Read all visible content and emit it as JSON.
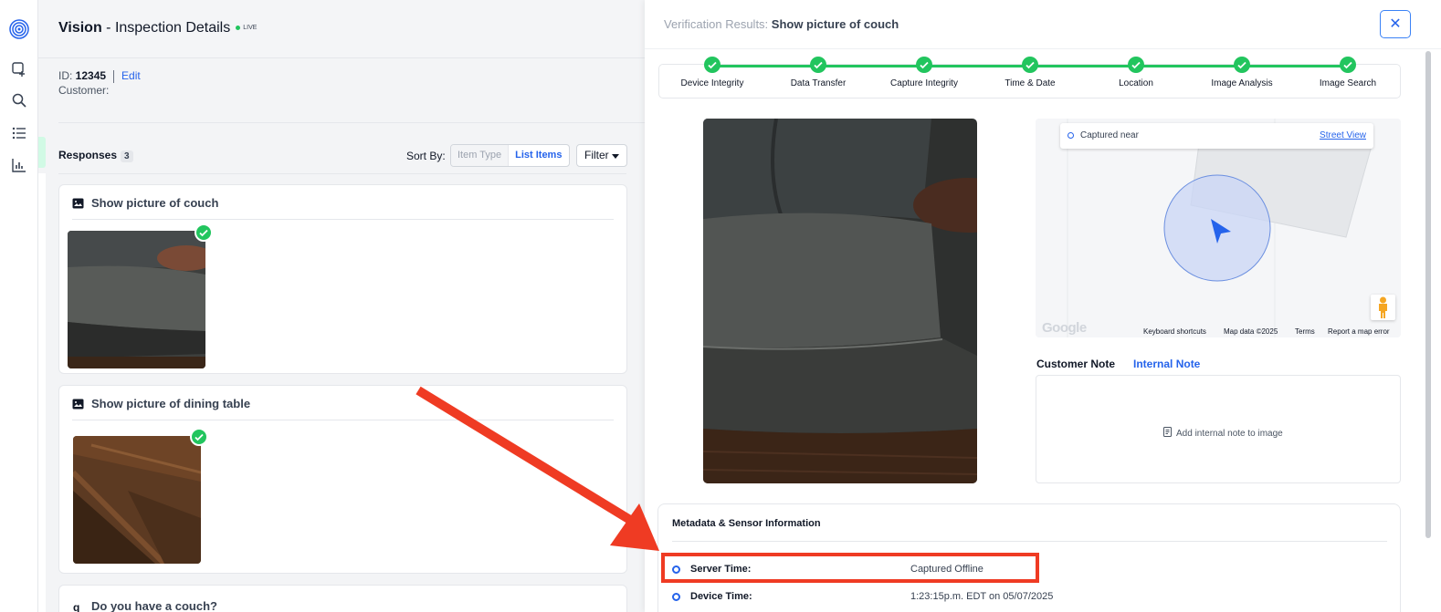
{
  "header": {
    "app_name": "Vision",
    "title_rest": " - Inspection Details",
    "live_label": "LIVE"
  },
  "inspection": {
    "id_label": "ID: ",
    "id_value": "12345",
    "edit_label": "Edit",
    "customer_label": "Customer:"
  },
  "responses": {
    "label": "Responses",
    "count": "3",
    "sort_by_label": "Sort By:",
    "sort_options": [
      "Item Type",
      "List Items"
    ],
    "selected_sort": "List Items",
    "filter_label": "Filter"
  },
  "cards": [
    {
      "title": "Show picture of couch",
      "verified": true
    },
    {
      "title": "Show picture of dining table",
      "verified": true
    },
    {
      "title": "Do you have a couch?"
    }
  ],
  "panel": {
    "title_prefix": "Verification Results: ",
    "title_item": "Show picture of couch",
    "close_label": "✕",
    "steps": [
      "Device Integrity",
      "Data Transfer",
      "Capture Integrity",
      "Time & Date",
      "Location",
      "Image Analysis",
      "Image Search"
    ],
    "map": {
      "captured_near_label": "Captured near",
      "street_view_label": "Street View",
      "google_label": "Google",
      "keyboard_shortcuts": "Keyboard shortcuts",
      "map_data": "Map data ©2025",
      "terms": "Terms",
      "report": "Report a map error"
    },
    "notes": {
      "customer_tab": "Customer Note",
      "internal_tab": "Internal Note",
      "add_note": "Add internal note to image"
    },
    "metadata": {
      "heading": "Metadata & Sensor Information",
      "rows": [
        {
          "label": "Server Time:",
          "value": "Captured Offline"
        },
        {
          "label": "Device Time:",
          "value": "1:23:15p.m. EDT on 05/07/2025"
        }
      ]
    }
  },
  "colors": {
    "accent": "#2563eb",
    "success": "#22c55e",
    "annotation_red": "#ef3b23"
  },
  "icons": [
    "app-logo-icon",
    "add-inspection-icon",
    "search-icon",
    "list-icon",
    "chart-icon",
    "image-icon",
    "check-icon",
    "close-icon",
    "pegman-icon",
    "note-icon",
    "chevron-down-icon"
  ]
}
